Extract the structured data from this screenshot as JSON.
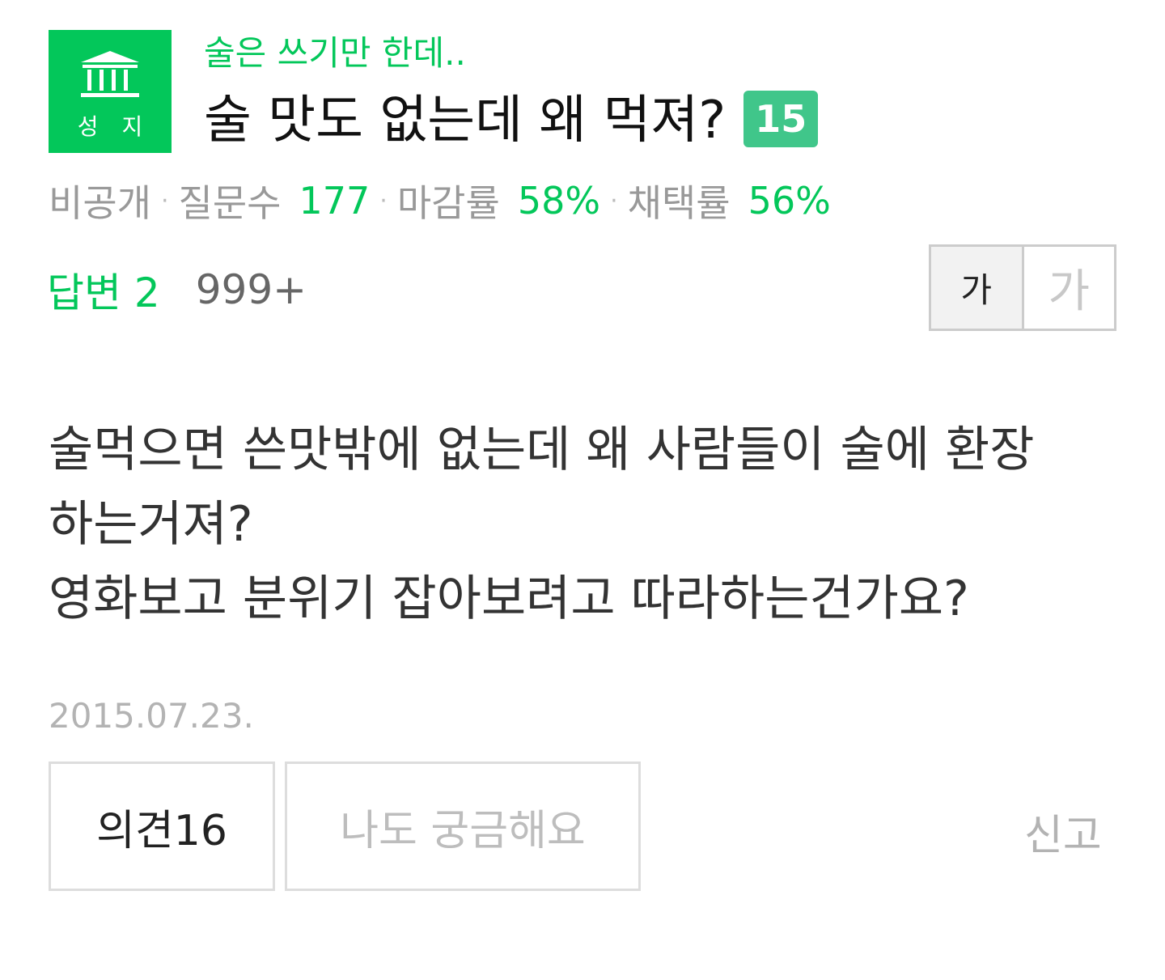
{
  "category_badge": {
    "icon": "pillar-building-icon",
    "label": "성 지",
    "color": "#03c75a"
  },
  "question": {
    "subtitle": "술은 쓰기만 한데..",
    "title": "술 맛도 없는데 왜 먹져?",
    "title_count": "15",
    "body_lines": [
      "술먹으면 쓴맛밖에 없는데 왜 사람들이 술에 환장",
      "하는거져?",
      "영화보고 분위기 잡아보려고 따라하는건가요?"
    ],
    "date": "2015.07.23."
  },
  "stats": {
    "visibility": "비공개",
    "questions_label": "질문수",
    "questions_value": "177",
    "close_rate_label": "마감률",
    "close_rate_value": "58%",
    "adopt_rate_label": "채택률",
    "adopt_rate_value": "56%"
  },
  "answers": {
    "label": "답변 2",
    "views": "999+"
  },
  "font_toggle": {
    "small_label": "가",
    "large_label": "가"
  },
  "actions": {
    "opinion_label": "의견16",
    "curious_label": "나도 궁금해요",
    "report_label": "신고"
  },
  "colors": {
    "accent": "#03c75a",
    "count_badge": "#40c68a"
  }
}
